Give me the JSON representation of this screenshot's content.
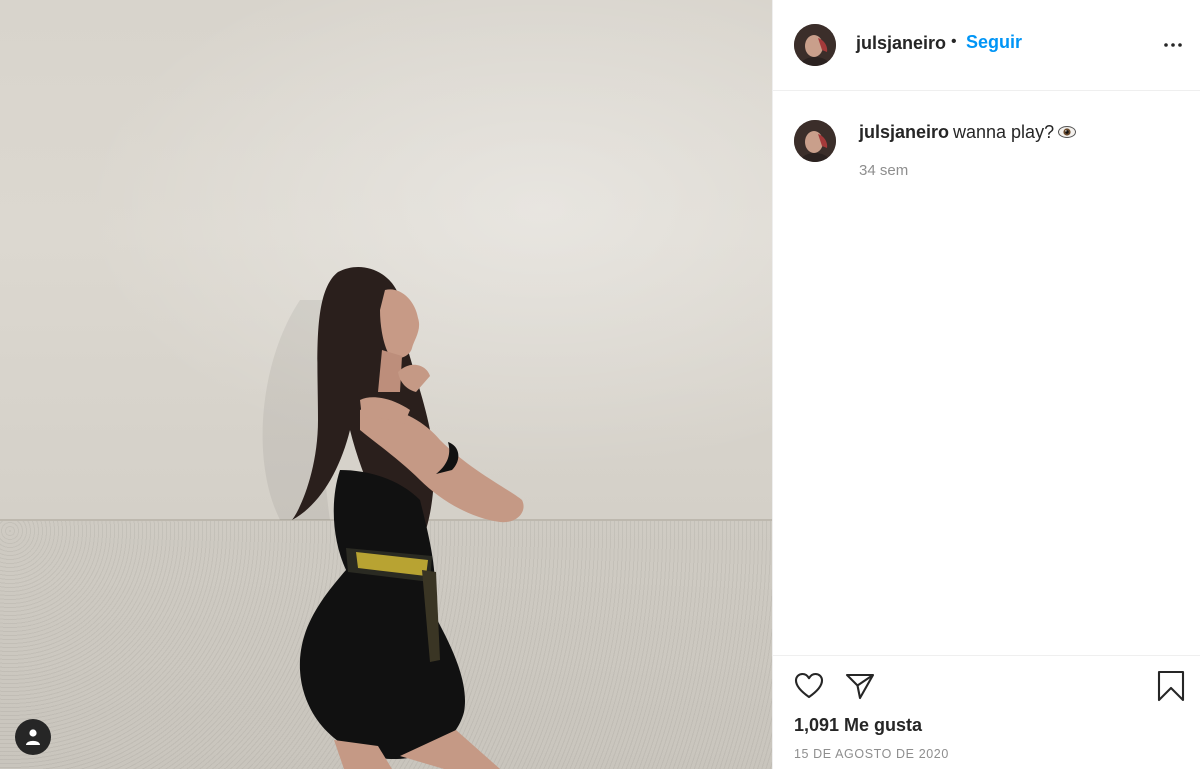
{
  "post": {
    "author": {
      "username": "julsjaneiro",
      "separator": "•",
      "follow_label": "Seguir"
    },
    "caption": {
      "username": "julsjaneiro",
      "text": "wanna play?",
      "emoji_icon": "eye-emoji-icon",
      "age": "34 sem"
    },
    "likes": "1,091 Me gusta",
    "date": "15 DE AGOSTO DE 2020"
  },
  "icons": {
    "more": "more-options-icon",
    "like": "heart-icon",
    "share": "paper-plane-icon",
    "save": "bookmark-icon",
    "user_tag": "user-tag-icon"
  },
  "colors": {
    "accent": "#0095f6",
    "text": "#262626",
    "muted": "#8e8e8e",
    "border": "#efefef"
  }
}
